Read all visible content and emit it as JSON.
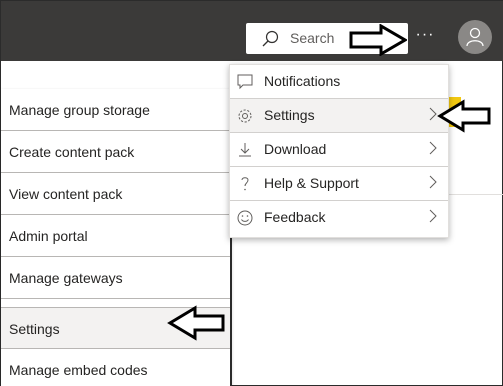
{
  "topbar": {
    "search_placeholder": "Search",
    "more_label": "···",
    "background_color": "#3b3a39"
  },
  "left_menu": {
    "items": [
      {
        "label": "Manage group storage"
      },
      {
        "label": "Create content pack"
      },
      {
        "label": "View content pack"
      },
      {
        "label": "Admin portal"
      },
      {
        "label": "Manage gateways"
      },
      {
        "label": "Settings",
        "selected": true
      },
      {
        "label": "Manage embed codes"
      }
    ]
  },
  "settings_menu": {
    "items": [
      {
        "label": "Notifications",
        "icon": "notification-icon",
        "has_submenu": false
      },
      {
        "label": "Settings",
        "icon": "gear-icon",
        "has_submenu": true
      },
      {
        "label": "Download",
        "icon": "download-icon",
        "has_submenu": true
      },
      {
        "label": "Help & Support",
        "icon": "help-icon",
        "has_submenu": true
      },
      {
        "label": "Feedback",
        "icon": "smiley-icon",
        "has_submenu": true
      }
    ]
  },
  "colors": {
    "accent": "#f2c811",
    "hover_bg": "#f3f2f1"
  }
}
